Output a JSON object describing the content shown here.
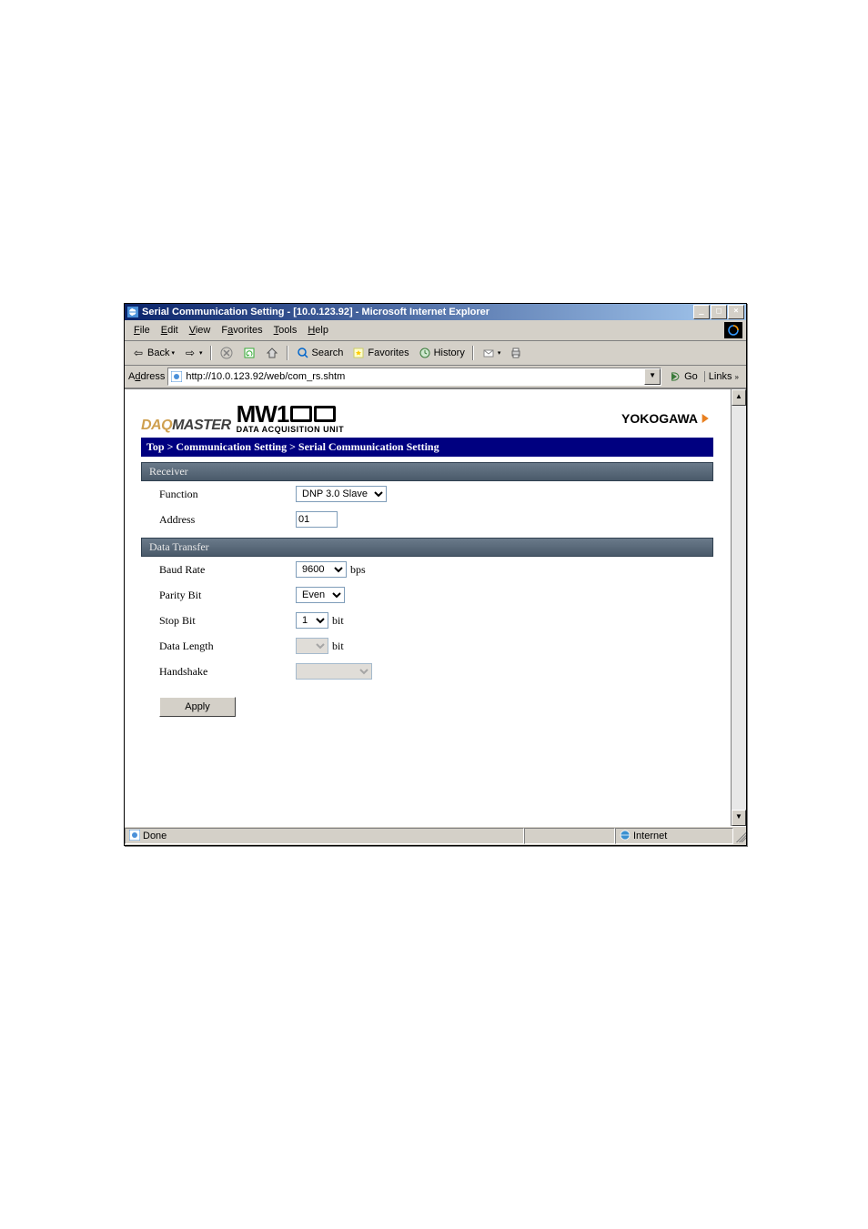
{
  "window": {
    "title": "Serial Communication Setting - [10.0.123.92] - Microsoft Internet Explorer"
  },
  "menubar": {
    "file": "File",
    "edit": "Edit",
    "view": "View",
    "favorites": "Favorites",
    "tools": "Tools",
    "help": "Help"
  },
  "toolbar": {
    "back": "Back",
    "search": "Search",
    "favorites": "Favorites",
    "history": "History"
  },
  "addressbar": {
    "label": "Address",
    "url": "http://10.0.123.92/web/com_rs.shtm",
    "go": "Go",
    "links": "Links"
  },
  "brand": {
    "daq": "DAQ",
    "master": "MASTER",
    "product_main": "MW1",
    "product_sub": "DATA ACQUISITION UNIT",
    "company": "YOKOGAWA"
  },
  "breadcrumb": "Top > Communication Setting > Serial Communication Setting",
  "sections": {
    "receiver": "Receiver",
    "data_transfer": "Data Transfer"
  },
  "fields": {
    "function": {
      "label": "Function",
      "value": "DNP 3.0 Slave"
    },
    "address": {
      "label": "Address",
      "value": "01"
    },
    "baud": {
      "label": "Baud Rate",
      "value": "9600",
      "unit": "bps"
    },
    "parity": {
      "label": "Parity Bit",
      "value": "Even"
    },
    "stopbit": {
      "label": "Stop Bit",
      "value": "1",
      "unit": "bit"
    },
    "datalen": {
      "label": "Data Length",
      "value": "",
      "unit": "bit"
    },
    "handshake": {
      "label": "Handshake",
      "value": ""
    }
  },
  "buttons": {
    "apply": "Apply"
  },
  "statusbar": {
    "done": "Done",
    "zone": "Internet"
  }
}
